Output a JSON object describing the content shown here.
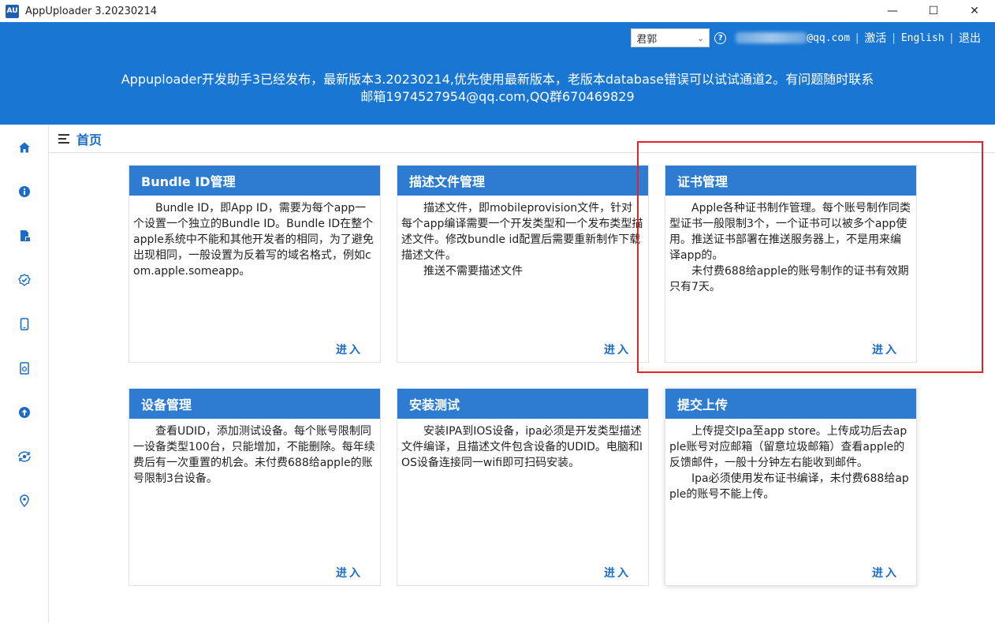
{
  "window": {
    "logo": "AU",
    "title": "AppUploader 3.20230214",
    "minimize": "—",
    "maximize": "☐",
    "close": "✕"
  },
  "header": {
    "user": "君郭",
    "email_suffix": "@qq.com",
    "activate": "激活",
    "english": "English",
    "logout": "退出",
    "announcement_line1": "Appuploader开发助手3已经发布，最新版本3.20230214,优先使用最新版本，老版本database错误可以试试通道2。有问题随时联系",
    "announcement_line2": "邮箱1974527954@qq.com,QQ群670469829"
  },
  "sidebar": {
    "items": [
      "home-icon",
      "info-icon",
      "file-icon",
      "badge-check-icon",
      "phone-icon",
      "app-file-icon",
      "upload-icon",
      "sync-eye-icon",
      "location-icon"
    ]
  },
  "breadcrumb": {
    "title": "首页"
  },
  "cards": [
    {
      "title": "Bundle ID管理",
      "body": "　　Bundle ID，即App ID，需要为每个app一个设置一个独立的Bundle ID。Bundle ID在整个apple系统中不能和其他开发者的相同，为了避免出现相同，一般设置为反着写的域名格式，例如com.apple.someapp。",
      "enter": "进入"
    },
    {
      "title": "描述文件管理",
      "body": "　　描述文件，即mobileprovision文件，针对每个app编译需要一个开发类型和一个发布类型描述文件。修改bundle id配置后需要重新制作下载描述文件。\n　　推送不需要描述文件",
      "enter": "进入"
    },
    {
      "title": "证书管理",
      "body": "　　Apple各种证书制作管理。每个账号制作同类型证书一般限制3个，一个证书可以被多个app使用。推送证书部署在推送服务器上，不是用来编译app的。\n　　未付费688给apple的账号制作的证书有效期只有7天。",
      "enter": "进入"
    },
    {
      "title": "设备管理",
      "body": "　　查看UDID，添加测试设备。每个账号限制同一设备类型100台，只能增加，不能删除。每年续费后有一次重置的机会。未付费688给apple的账号限制3台设备。",
      "enter": "进入"
    },
    {
      "title": "安装测试",
      "body": "　　安装IPA到IOS设备，ipa必须是开发类型描述文件编译，且描述文件包含设备的UDID。电脑和IOS设备连接同一wifi即可扫码安装。",
      "enter": "进入"
    },
    {
      "title": "提交上传",
      "body": "　　上传提交Ipa至app store。上传成功后去apple账号对应邮箱（留意垃圾邮箱）查看apple的反馈邮件，一般十分钟左右能收到邮件。\n　　Ipa必须使用发布证书编译，未付费688给apple的账号不能上传。",
      "enter": "进入"
    }
  ],
  "colors": {
    "header_bg": "#1976d2",
    "card_head": "#2e7cd1",
    "link": "#1a6cc7",
    "highlight": "#e0242a"
  }
}
